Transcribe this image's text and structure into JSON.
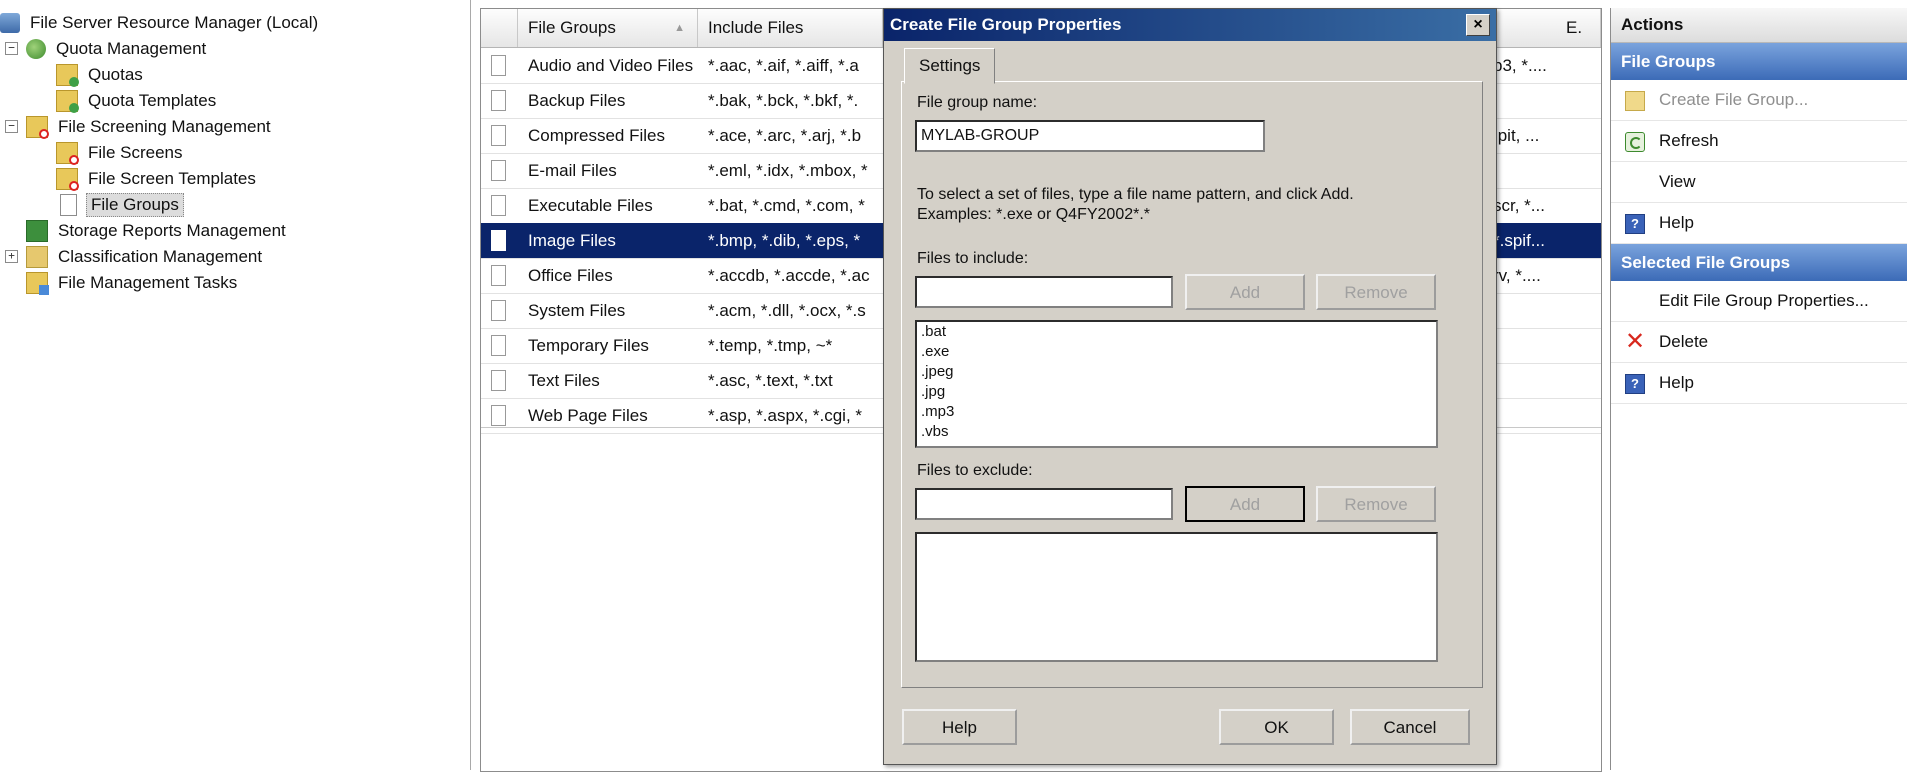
{
  "tree": {
    "root": "File Server Resource Manager (Local)",
    "quota_management": "Quota Management",
    "quotas": "Quotas",
    "quota_templates": "Quota Templates",
    "file_screening_management": "File Screening Management",
    "file_screens": "File Screens",
    "file_screen_templates": "File Screen Templates",
    "file_groups": "File Groups",
    "storage_reports": "Storage Reports Management",
    "classification": "Classification Management",
    "file_management_tasks": "File Management Tasks"
  },
  "list": {
    "columns": [
      "File Groups",
      "Include Files",
      "E."
    ],
    "rows": [
      {
        "name": "Audio and Video Files",
        "include": "*.aac, *.aif, *.aiff, *.a",
        "exclude": "p3, *...."
      },
      {
        "name": "Backup Files",
        "include": "*.bak, *.bck, *.bkf, *.",
        "exclude": ""
      },
      {
        "name": "Compressed Files",
        "include": "*.ace, *.arc, *.arj, *.b",
        "exclude": ".pit, ..."
      },
      {
        "name": "E-mail Files",
        "include": "*.eml, *.idx, *.mbox, *",
        "exclude": ""
      },
      {
        "name": "Executable Files",
        "include": "*.bat, *.cmd, *.com, *",
        "exclude": "scr, *..."
      },
      {
        "name": "Image Files",
        "include": "*.bmp, *.dib, *.eps, *",
        "exclude": "*.spif..."
      },
      {
        "name": "Office Files",
        "include": "*.accdb, *.accde, *.ac",
        "exclude": "rv, *...."
      },
      {
        "name": "System Files",
        "include": "*.acm, *.dll, *.ocx, *.s",
        "exclude": ""
      },
      {
        "name": "Temporary Files",
        "include": "*.temp, *.tmp, ~*",
        "exclude": ""
      },
      {
        "name": "Text Files",
        "include": "*.asc, *.text, *.txt",
        "exclude": ""
      },
      {
        "name": "Web Page Files",
        "include": "*.asp, *.aspx, *.cgi, *",
        "exclude": ""
      }
    ],
    "selected_index": 5
  },
  "actions": {
    "title": "Actions",
    "section1": "File Groups",
    "create": "Create File Group...",
    "refresh": "Refresh",
    "view": "View",
    "help1": "Help",
    "section2": "Selected File Groups",
    "edit": "Edit File Group Properties...",
    "delete": "Delete",
    "help2": "Help"
  },
  "dialog": {
    "title": "Create File Group Properties",
    "close": "×",
    "tab": "Settings",
    "group_name_label": "File group name:",
    "group_name_value": "MYLAB-GROUP",
    "instructions_line1": "To select a set of files, type a file name pattern, and click Add.",
    "instructions_line2": "Examples: *.exe or Q4FY2002*.*",
    "include_label": "Files to include:",
    "include_input": "",
    "include_items": [
      ".bat",
      ".exe",
      ".jpeg",
      ".jpg",
      ".mp3",
      ".vbs"
    ],
    "exclude_label": "Files to exclude:",
    "exclude_input": "",
    "add": "Add",
    "remove": "Remove",
    "help": "Help",
    "ok": "OK",
    "cancel": "Cancel"
  }
}
